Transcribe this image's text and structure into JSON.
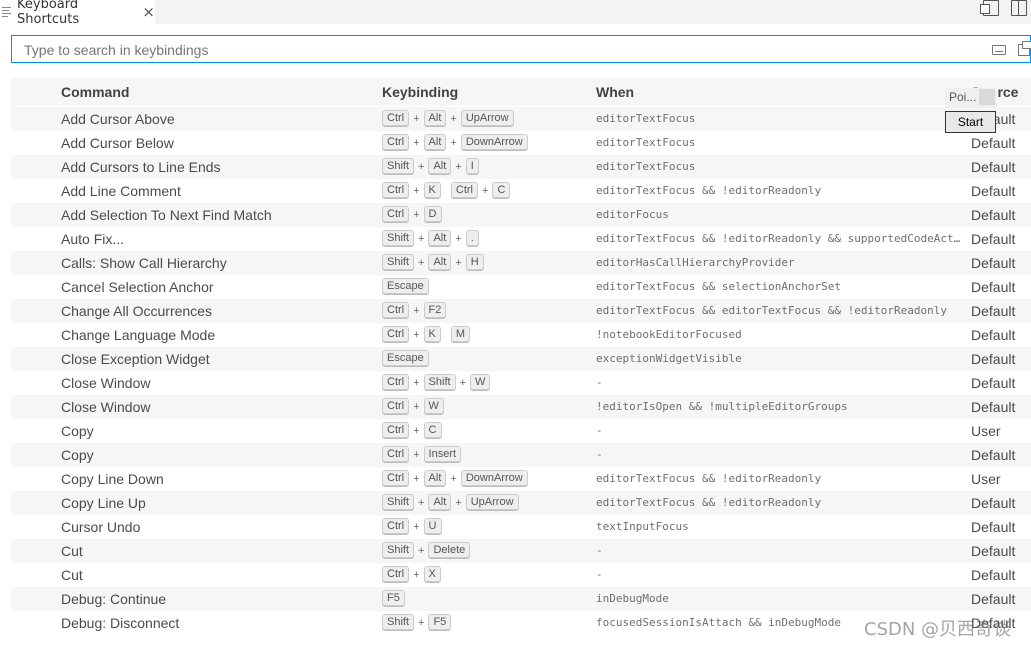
{
  "tab": {
    "title": "Keyboard Shortcuts",
    "close": "×"
  },
  "search": {
    "placeholder": "Type to search in keybindings"
  },
  "columns": {
    "command": "Command",
    "keybinding": "Keybinding",
    "when": "When",
    "source": "Source"
  },
  "overlay": {
    "label": "Poi...",
    "button": "Start"
  },
  "watermark": "CSDN @贝西奇谈",
  "rows": [
    {
      "command": "Add Cursor Above",
      "keys": [
        [
          "Ctrl",
          "Alt",
          "UpArrow"
        ]
      ],
      "when": "editorTextFocus",
      "source": "Default"
    },
    {
      "command": "Add Cursor Below",
      "keys": [
        [
          "Ctrl",
          "Alt",
          "DownArrow"
        ]
      ],
      "when": "editorTextFocus",
      "source": "Default"
    },
    {
      "command": "Add Cursors to Line Ends",
      "keys": [
        [
          "Shift",
          "Alt",
          "I"
        ]
      ],
      "when": "editorTextFocus",
      "source": "Default"
    },
    {
      "command": "Add Line Comment",
      "keys": [
        [
          "Ctrl",
          "K"
        ],
        [
          "Ctrl",
          "C"
        ]
      ],
      "when": "editorTextFocus && !editorReadonly",
      "source": "Default"
    },
    {
      "command": "Add Selection To Next Find Match",
      "keys": [
        [
          "Ctrl",
          "D"
        ]
      ],
      "when": "editorFocus",
      "source": "Default"
    },
    {
      "command": "Auto Fix...",
      "keys": [
        [
          "Shift",
          "Alt",
          "."
        ]
      ],
      "when": "editorTextFocus && !editorReadonly && supportedCodeActi…",
      "source": "Default"
    },
    {
      "command": "Calls: Show Call Hierarchy",
      "keys": [
        [
          "Shift",
          "Alt",
          "H"
        ]
      ],
      "when": "editorHasCallHierarchyProvider",
      "source": "Default"
    },
    {
      "command": "Cancel Selection Anchor",
      "keys": [
        [
          "Escape"
        ]
      ],
      "when": "editorTextFocus && selectionAnchorSet",
      "source": "Default"
    },
    {
      "command": "Change All Occurrences",
      "keys": [
        [
          "Ctrl",
          "F2"
        ]
      ],
      "when": "editorTextFocus && editorTextFocus && !editorReadonly",
      "source": "Default"
    },
    {
      "command": "Change Language Mode",
      "keys": [
        [
          "Ctrl",
          "K"
        ],
        [
          "M"
        ]
      ],
      "when": "!notebookEditorFocused",
      "source": "Default"
    },
    {
      "command": "Close Exception Widget",
      "keys": [
        [
          "Escape"
        ]
      ],
      "when": "exceptionWidgetVisible",
      "source": "Default"
    },
    {
      "command": "Close Window",
      "keys": [
        [
          "Ctrl",
          "Shift",
          "W"
        ]
      ],
      "when": "-",
      "source": "Default"
    },
    {
      "command": "Close Window",
      "keys": [
        [
          "Ctrl",
          "W"
        ]
      ],
      "when": "!editorIsOpen && !multipleEditorGroups",
      "source": "Default"
    },
    {
      "command": "Copy",
      "keys": [
        [
          "Ctrl",
          "C"
        ]
      ],
      "when": "-",
      "source": "User"
    },
    {
      "command": "Copy",
      "keys": [
        [
          "Ctrl",
          "Insert"
        ]
      ],
      "when": "-",
      "source": "Default"
    },
    {
      "command": "Copy Line Down",
      "keys": [
        [
          "Ctrl",
          "Alt",
          "DownArrow"
        ]
      ],
      "when": "editorTextFocus && !editorReadonly",
      "source": "User"
    },
    {
      "command": "Copy Line Up",
      "keys": [
        [
          "Shift",
          "Alt",
          "UpArrow"
        ]
      ],
      "when": "editorTextFocus && !editorReadonly",
      "source": "Default"
    },
    {
      "command": "Cursor Undo",
      "keys": [
        [
          "Ctrl",
          "U"
        ]
      ],
      "when": "textInputFocus",
      "source": "Default"
    },
    {
      "command": "Cut",
      "keys": [
        [
          "Shift",
          "Delete"
        ]
      ],
      "when": "-",
      "source": "Default"
    },
    {
      "command": "Cut",
      "keys": [
        [
          "Ctrl",
          "X"
        ]
      ],
      "when": "-",
      "source": "Default"
    },
    {
      "command": "Debug: Continue",
      "keys": [
        [
          "F5"
        ]
      ],
      "when": "inDebugMode",
      "source": "Default"
    },
    {
      "command": "Debug: Disconnect",
      "keys": [
        [
          "Shift",
          "F5"
        ]
      ],
      "when": "focusedSessionIsAttach && inDebugMode",
      "source": "Default"
    }
  ]
}
